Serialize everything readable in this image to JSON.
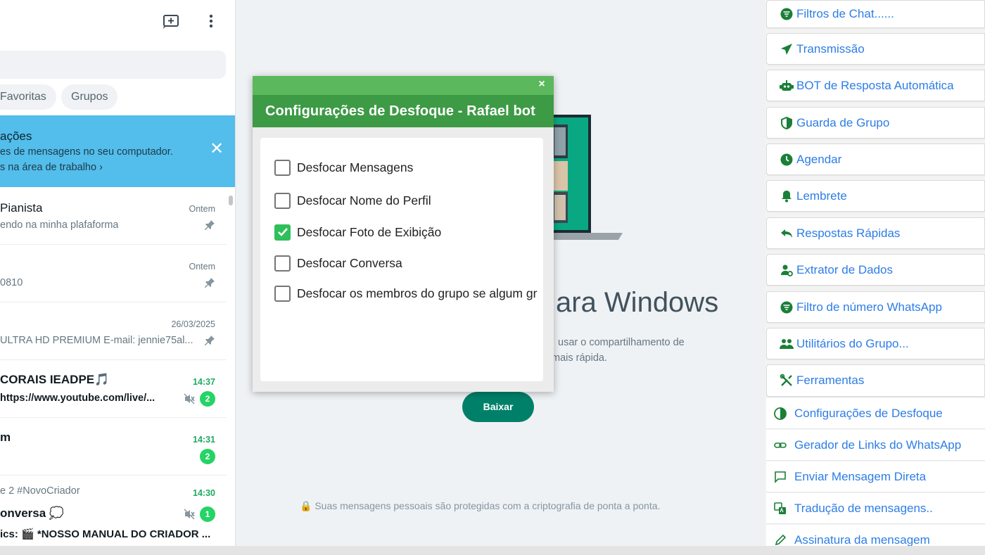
{
  "sidebar": {
    "filters": [
      "Favoritas",
      "Grupos"
    ],
    "notice": {
      "title": "ações",
      "line1": "es de mensagens no seu computador.",
      "line2": "s na área de trabalho ›"
    },
    "chats": [
      {
        "name": "Pianista",
        "preview": "endo na minha plafaforma",
        "time": "Ontem",
        "pinned": true
      },
      {
        "name": "",
        "preview": "0810",
        "time": "Ontem",
        "pinned": true
      },
      {
        "name": "",
        "preview": "ULTRA HD PREMIUM E-mail: jennie75al...",
        "time": "26/03/2025",
        "pinned": true
      },
      {
        "name": "CORAIS IEADPE🎵",
        "preview": "https://www.youtube.com/live/...",
        "time": "14:37",
        "unread": "2",
        "muted": true
      },
      {
        "name": "m",
        "preview": "",
        "time": "14:31",
        "unread": "2"
      },
      {
        "sub": "e 2 #NovoCriador",
        "name": "onversa 💭",
        "preview": "ics: 🎬 *NOSSO MANUAL DO CRIADOR ...",
        "time": "14:30",
        "unread": "1",
        "muted": true
      }
    ]
  },
  "center": {
    "heading": "ara Windows",
    "desc_line1": "usar o compartilhamento de",
    "desc_line2": "mais rápida.",
    "download_label": "Baixar",
    "encryption_note": "🔒 Suas mensagens pessoais são protegidas com a criptografia de ponta a ponta."
  },
  "dialog": {
    "close": "×",
    "title": "Configurações de Desfoque - Rafael bot",
    "options": [
      {
        "label": "Desfocar Mensagens",
        "checked": false
      },
      {
        "label": "Desfocar Nome do Perfil",
        "checked": false
      },
      {
        "label": "Desfocar Foto de Exibição",
        "checked": true
      },
      {
        "label": "Desfocar Conversa",
        "checked": false
      },
      {
        "label": "Desfocar os membros do grupo se algum gr",
        "checked": false
      }
    ]
  },
  "toolbox": {
    "accent_color": "#2d7de6",
    "icon_color": "#1a7f37",
    "items": [
      {
        "label": "Filtros de Chat......",
        "icon": "filter-icon"
      },
      {
        "label": "Transmissão",
        "icon": "send-icon"
      },
      {
        "label": "BOT de Resposta Automática",
        "icon": "robot-icon"
      },
      {
        "label": "Guarda de Grupo",
        "icon": "shield-icon"
      },
      {
        "label": "Agendar",
        "icon": "clock-icon"
      },
      {
        "label": "Lembrete",
        "icon": "bell-icon"
      },
      {
        "label": "Respostas Rápidas",
        "icon": "reply-icon"
      },
      {
        "label": "Extrator de Dados",
        "icon": "user-gear-icon"
      },
      {
        "label": "Filtro de número WhatsApp",
        "icon": "filter-icon"
      },
      {
        "label": "Utilitários do Grupo...",
        "icon": "users-icon"
      },
      {
        "label": "Ferramentas",
        "icon": "tools-icon"
      }
    ],
    "subitems": [
      {
        "label": "Configurações de Desfoque",
        "icon": "half-circle-icon"
      },
      {
        "label": "Gerador de Links do WhatsApp",
        "icon": "link-icon"
      },
      {
        "label": "Enviar Mensagem Direta",
        "icon": "chat-bubble-icon"
      },
      {
        "label": "Tradução de mensagens..",
        "icon": "translate-icon"
      },
      {
        "label": "Assinatura da mensagem",
        "icon": "pen-icon"
      }
    ]
  }
}
